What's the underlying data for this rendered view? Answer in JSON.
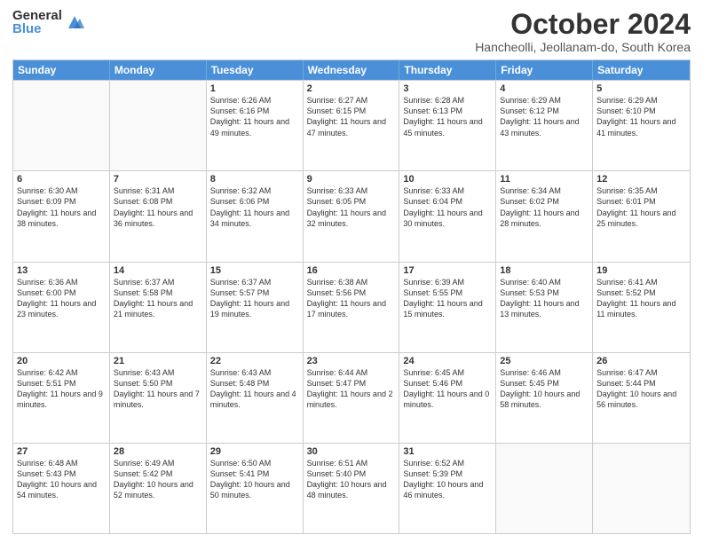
{
  "logo": {
    "general": "General",
    "blue": "Blue"
  },
  "title": "October 2024",
  "location": "Hancheolli, Jeollanam-do, South Korea",
  "days": [
    "Sunday",
    "Monday",
    "Tuesday",
    "Wednesday",
    "Thursday",
    "Friday",
    "Saturday"
  ],
  "weeks": [
    [
      {
        "day": "",
        "empty": true
      },
      {
        "day": "",
        "empty": true
      },
      {
        "day": "1",
        "sunrise": "Sunrise: 6:26 AM",
        "sunset": "Sunset: 6:16 PM",
        "daylight": "Daylight: 11 hours and 49 minutes."
      },
      {
        "day": "2",
        "sunrise": "Sunrise: 6:27 AM",
        "sunset": "Sunset: 6:15 PM",
        "daylight": "Daylight: 11 hours and 47 minutes."
      },
      {
        "day": "3",
        "sunrise": "Sunrise: 6:28 AM",
        "sunset": "Sunset: 6:13 PM",
        "daylight": "Daylight: 11 hours and 45 minutes."
      },
      {
        "day": "4",
        "sunrise": "Sunrise: 6:29 AM",
        "sunset": "Sunset: 6:12 PM",
        "daylight": "Daylight: 11 hours and 43 minutes."
      },
      {
        "day": "5",
        "sunrise": "Sunrise: 6:29 AM",
        "sunset": "Sunset: 6:10 PM",
        "daylight": "Daylight: 11 hours and 41 minutes."
      }
    ],
    [
      {
        "day": "6",
        "sunrise": "Sunrise: 6:30 AM",
        "sunset": "Sunset: 6:09 PM",
        "daylight": "Daylight: 11 hours and 38 minutes."
      },
      {
        "day": "7",
        "sunrise": "Sunrise: 6:31 AM",
        "sunset": "Sunset: 6:08 PM",
        "daylight": "Daylight: 11 hours and 36 minutes."
      },
      {
        "day": "8",
        "sunrise": "Sunrise: 6:32 AM",
        "sunset": "Sunset: 6:06 PM",
        "daylight": "Daylight: 11 hours and 34 minutes."
      },
      {
        "day": "9",
        "sunrise": "Sunrise: 6:33 AM",
        "sunset": "Sunset: 6:05 PM",
        "daylight": "Daylight: 11 hours and 32 minutes."
      },
      {
        "day": "10",
        "sunrise": "Sunrise: 6:33 AM",
        "sunset": "Sunset: 6:04 PM",
        "daylight": "Daylight: 11 hours and 30 minutes."
      },
      {
        "day": "11",
        "sunrise": "Sunrise: 6:34 AM",
        "sunset": "Sunset: 6:02 PM",
        "daylight": "Daylight: 11 hours and 28 minutes."
      },
      {
        "day": "12",
        "sunrise": "Sunrise: 6:35 AM",
        "sunset": "Sunset: 6:01 PM",
        "daylight": "Daylight: 11 hours and 25 minutes."
      }
    ],
    [
      {
        "day": "13",
        "sunrise": "Sunrise: 6:36 AM",
        "sunset": "Sunset: 6:00 PM",
        "daylight": "Daylight: 11 hours and 23 minutes."
      },
      {
        "day": "14",
        "sunrise": "Sunrise: 6:37 AM",
        "sunset": "Sunset: 5:58 PM",
        "daylight": "Daylight: 11 hours and 21 minutes."
      },
      {
        "day": "15",
        "sunrise": "Sunrise: 6:37 AM",
        "sunset": "Sunset: 5:57 PM",
        "daylight": "Daylight: 11 hours and 19 minutes."
      },
      {
        "day": "16",
        "sunrise": "Sunrise: 6:38 AM",
        "sunset": "Sunset: 5:56 PM",
        "daylight": "Daylight: 11 hours and 17 minutes."
      },
      {
        "day": "17",
        "sunrise": "Sunrise: 6:39 AM",
        "sunset": "Sunset: 5:55 PM",
        "daylight": "Daylight: 11 hours and 15 minutes."
      },
      {
        "day": "18",
        "sunrise": "Sunrise: 6:40 AM",
        "sunset": "Sunset: 5:53 PM",
        "daylight": "Daylight: 11 hours and 13 minutes."
      },
      {
        "day": "19",
        "sunrise": "Sunrise: 6:41 AM",
        "sunset": "Sunset: 5:52 PM",
        "daylight": "Daylight: 11 hours and 11 minutes."
      }
    ],
    [
      {
        "day": "20",
        "sunrise": "Sunrise: 6:42 AM",
        "sunset": "Sunset: 5:51 PM",
        "daylight": "Daylight: 11 hours and 9 minutes."
      },
      {
        "day": "21",
        "sunrise": "Sunrise: 6:43 AM",
        "sunset": "Sunset: 5:50 PM",
        "daylight": "Daylight: 11 hours and 7 minutes."
      },
      {
        "day": "22",
        "sunrise": "Sunrise: 6:43 AM",
        "sunset": "Sunset: 5:48 PM",
        "daylight": "Daylight: 11 hours and 4 minutes."
      },
      {
        "day": "23",
        "sunrise": "Sunrise: 6:44 AM",
        "sunset": "Sunset: 5:47 PM",
        "daylight": "Daylight: 11 hours and 2 minutes."
      },
      {
        "day": "24",
        "sunrise": "Sunrise: 6:45 AM",
        "sunset": "Sunset: 5:46 PM",
        "daylight": "Daylight: 11 hours and 0 minutes."
      },
      {
        "day": "25",
        "sunrise": "Sunrise: 6:46 AM",
        "sunset": "Sunset: 5:45 PM",
        "daylight": "Daylight: 10 hours and 58 minutes."
      },
      {
        "day": "26",
        "sunrise": "Sunrise: 6:47 AM",
        "sunset": "Sunset: 5:44 PM",
        "daylight": "Daylight: 10 hours and 56 minutes."
      }
    ],
    [
      {
        "day": "27",
        "sunrise": "Sunrise: 6:48 AM",
        "sunset": "Sunset: 5:43 PM",
        "daylight": "Daylight: 10 hours and 54 minutes."
      },
      {
        "day": "28",
        "sunrise": "Sunrise: 6:49 AM",
        "sunset": "Sunset: 5:42 PM",
        "daylight": "Daylight: 10 hours and 52 minutes."
      },
      {
        "day": "29",
        "sunrise": "Sunrise: 6:50 AM",
        "sunset": "Sunset: 5:41 PM",
        "daylight": "Daylight: 10 hours and 50 minutes."
      },
      {
        "day": "30",
        "sunrise": "Sunrise: 6:51 AM",
        "sunset": "Sunset: 5:40 PM",
        "daylight": "Daylight: 10 hours and 48 minutes."
      },
      {
        "day": "31",
        "sunrise": "Sunrise: 6:52 AM",
        "sunset": "Sunset: 5:39 PM",
        "daylight": "Daylight: 10 hours and 46 minutes."
      },
      {
        "day": "",
        "empty": true
      },
      {
        "day": "",
        "empty": true
      }
    ]
  ]
}
